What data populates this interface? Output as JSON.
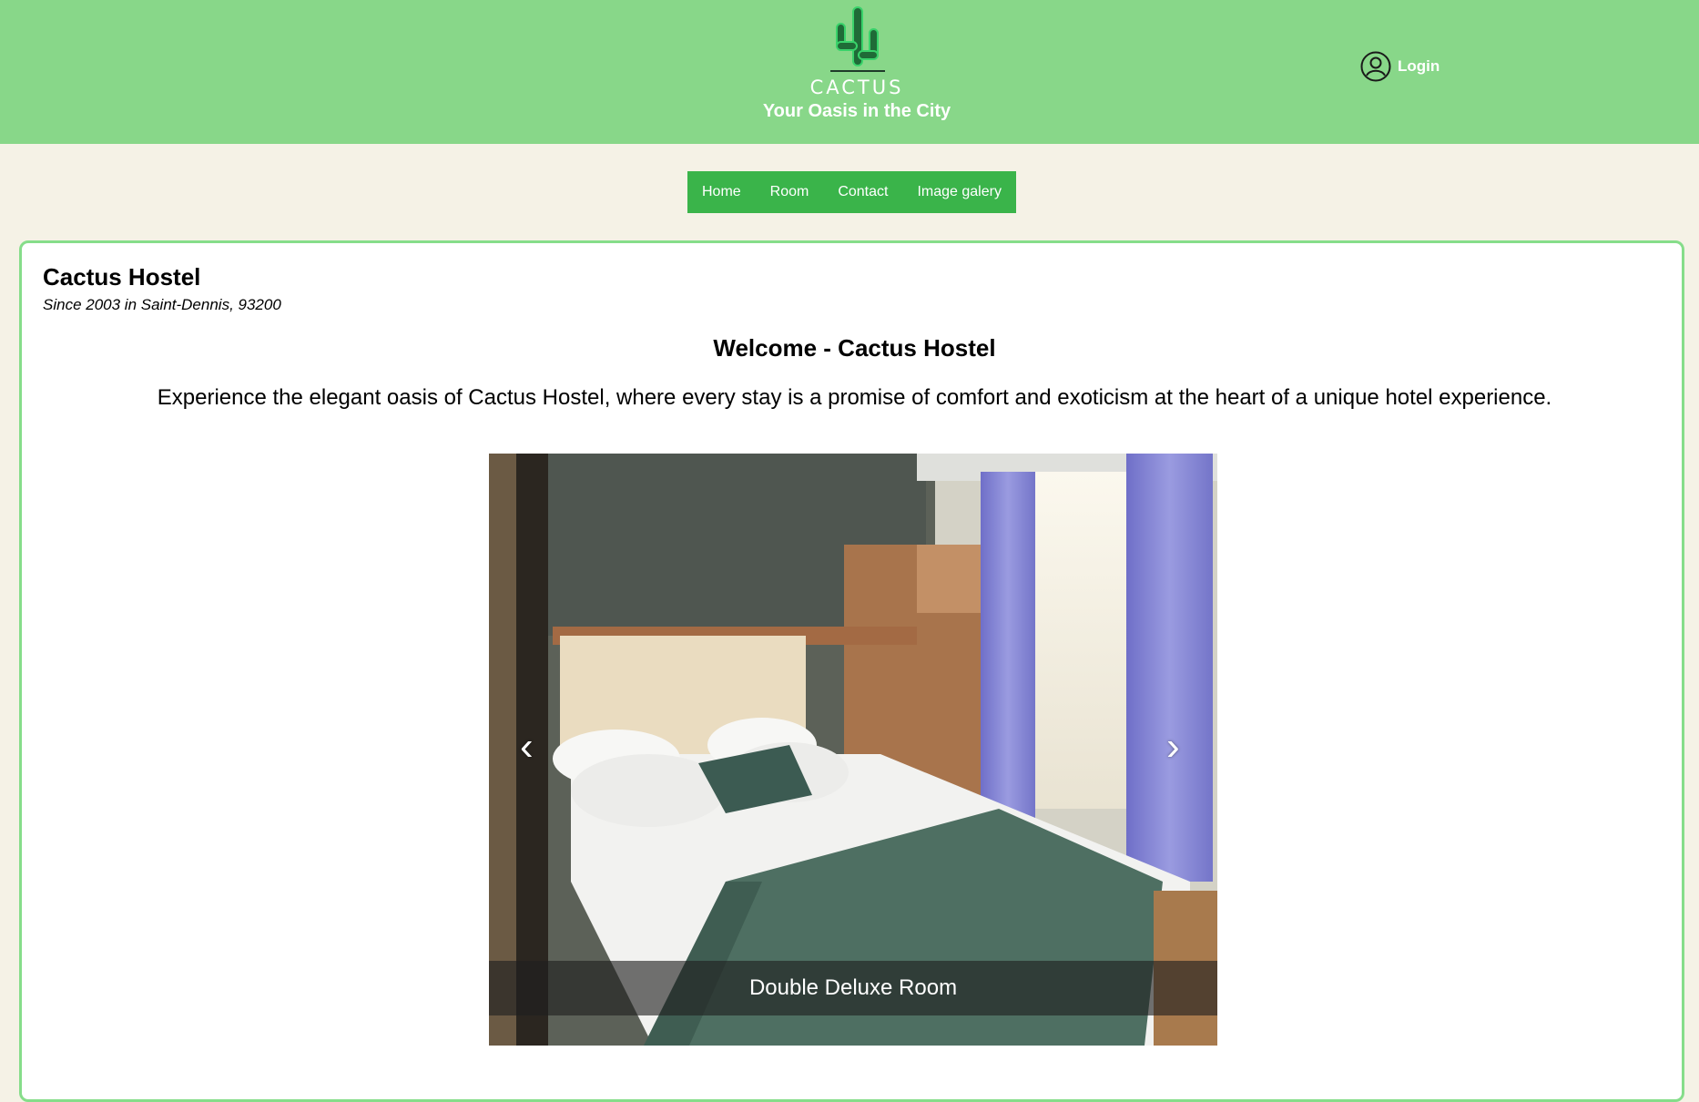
{
  "brand": {
    "name": "CACTUS",
    "tagline": "Your Oasis in the City"
  },
  "header": {
    "login_label": "Login"
  },
  "nav": {
    "items": [
      "Home",
      "Room",
      "Contact",
      "Image galery"
    ]
  },
  "hostel": {
    "name": "Cactus Hostel",
    "since": "Since 2003 in Saint-Dennis, 93200"
  },
  "welcome": {
    "title": "Welcome - Cactus Hostel",
    "intro": "Experience the elegant oasis of Cactus Hostel, where every stay is a promise of comfort and exoticism at the heart of a unique hotel experience."
  },
  "carousel": {
    "caption": "Double Deluxe Room",
    "prev_icon": "chevron-left-icon",
    "next_icon": "chevron-right-icon"
  },
  "colors": {
    "header_bg": "#88d789",
    "nav_bg": "#3ab44a",
    "card_border": "#86dd8a",
    "page_bg": "#f5f2e6"
  }
}
